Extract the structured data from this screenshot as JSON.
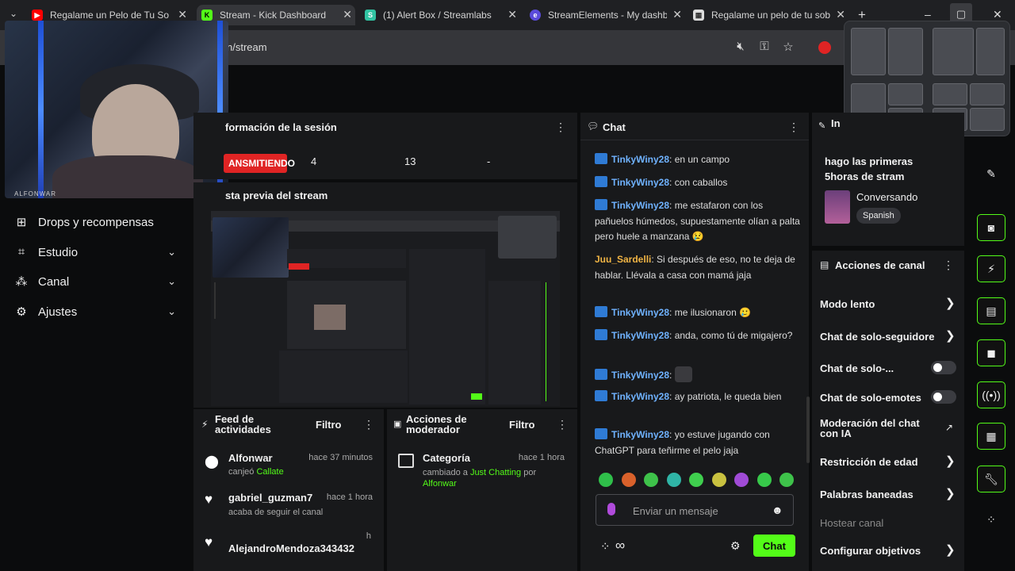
{
  "browser": {
    "tabs": [
      {
        "title": "Regalame un Pelo de Tu Sob",
        "favicon": "youtube-icon",
        "color": "#ff0000"
      },
      {
        "title": "Stream - Kick Dashboard",
        "favicon": "kick-icon",
        "color": "#53fc18"
      },
      {
        "title": "(1) Alert Box / Streamlabs",
        "favicon": "streamlabs-icon",
        "color": "#31c3a2"
      },
      {
        "title": "StreamElements - My dashb",
        "favicon": "streamelements-icon",
        "color": "#5b4bdb"
      },
      {
        "title": "Regalame un pelo de tu sob",
        "favicon": "page-icon",
        "color": "#dddddd"
      }
    ],
    "new_tab": "+",
    "url": "n/stream",
    "window_controls": {
      "minimize": "–",
      "maximize": "▢",
      "close": "✕"
    }
  },
  "webcam": {
    "label": "ALFONWAR"
  },
  "sidebar": {
    "items": [
      {
        "label": "Drops y recompensas",
        "icon": "gift-icon",
        "expandable": false
      },
      {
        "label": "Estudio",
        "icon": "studio-icon",
        "expandable": true
      },
      {
        "label": "Canal",
        "icon": "channel-icon",
        "expandable": true
      },
      {
        "label": "Ajustes",
        "icon": "gear-icon",
        "expandable": true
      }
    ]
  },
  "session": {
    "title": "formación de la sesión",
    "live_badge": "ANSMITIENDO",
    "stats": [
      "4",
      "13",
      "-"
    ]
  },
  "preview": {
    "title": "sta previa del stream"
  },
  "feed": {
    "title": "Feed de actividades",
    "filter": "Filtro",
    "items": [
      {
        "name": "Alfonwar",
        "time": "hace 37 minutos",
        "action_prefix": "canjeó",
        "action_highlight": "Callate",
        "icon": "redeem-icon"
      },
      {
        "name": "gabriel_guzman7",
        "time": "hace 1 hora",
        "action_prefix": "acaba de seguir el canal",
        "action_highlight": "",
        "icon": "heart-icon"
      },
      {
        "name": "AlejandroMendoza343432",
        "time": "h",
        "action_prefix": "",
        "action_highlight": "",
        "icon": "heart-icon"
      }
    ]
  },
  "mod_actions": {
    "title": "Acciones de moderador",
    "filter": "Filtro",
    "items": [
      {
        "name": "Categoría",
        "time": "hace 1 hora",
        "text1": "cambiado a",
        "highlight1": "Just Chatting",
        "text2": "por",
        "highlight2": "Alfonwar"
      }
    ]
  },
  "chat": {
    "title": "Chat",
    "messages": [
      {
        "user": "TinkyWiny28",
        "text": "en un campo",
        "vip": false
      },
      {
        "user": "TinkyWiny28",
        "text": "con caballos",
        "vip": false
      },
      {
        "user": "TinkyWiny28",
        "text": "me estafaron con los pañuelos húmedos, supuestamente olían a palta pero huele a manzana 😢",
        "vip": false
      },
      {
        "user": "Juu_Sardelli",
        "text": "Si después de eso, no te deja de hablar. Llévala a casa con mamá jaja",
        "vip": true
      },
      {
        "user": "TinkyWiny28",
        "text": "me ilusionaron 🥲",
        "vip": false
      },
      {
        "user": "TinkyWiny28",
        "text": "anda, como tú de migajero?",
        "vip": false
      },
      {
        "user": "TinkyWiny28",
        "text": "",
        "vip": false
      },
      {
        "user": "TinkyWiny28",
        "text": "ay patriota, le queda bien",
        "vip": false
      },
      {
        "user": "TinkyWiny28",
        "text": "yo estuve jugando con ChatGPT para teñirme el pelo jaja",
        "vip": false
      }
    ],
    "emotes": [
      "#2fbf4a",
      "#d9612b",
      "#3ec24a",
      "#2fb4a6",
      "#3fcf4e",
      "#c9c240",
      "#a04bd6",
      "#37c94a",
      "#3ec24a"
    ],
    "input_placeholder": "Enviar un mensaje",
    "send_label": "Chat"
  },
  "stream_info": {
    "title": "In",
    "stream_title": "hago las primeras 5horas de stram",
    "category": "Conversando",
    "language": "Spanish"
  },
  "channel_actions": {
    "title": "Acciones de canal",
    "items": [
      {
        "label": "Modo lento",
        "control": "chevron"
      },
      {
        "label": "Chat de solo-seguidore",
        "control": "chevron"
      },
      {
        "label": "Chat de solo-...",
        "control": "toggle"
      },
      {
        "label": "Chat de solo-emotes",
        "control": "toggle"
      },
      {
        "label": "Moderación del chat con IA",
        "control": "external"
      },
      {
        "label": "Restricción de edad",
        "control": "chevron"
      },
      {
        "label": "Palabras baneadas",
        "control": "chevron"
      },
      {
        "label": "Hostear canal",
        "control": "none"
      },
      {
        "label": "Configurar objetivos",
        "control": "chevron"
      }
    ]
  },
  "colors": {
    "brand": "#53fc18",
    "live": "#e02424",
    "panel": "#18191b"
  }
}
